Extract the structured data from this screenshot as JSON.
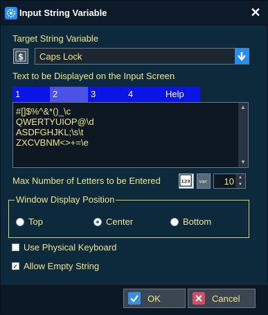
{
  "window": {
    "title": "Input String Variable"
  },
  "target": {
    "label": "Target String Variable",
    "selected": "Caps Lock",
    "icon": "string-variable-icon"
  },
  "display_text": {
    "label": "Text to be Displayed on the Input Screen",
    "tabs": [
      {
        "label": "1"
      },
      {
        "label": "2"
      },
      {
        "label": "3"
      },
      {
        "label": "4"
      },
      {
        "label": "Help"
      }
    ],
    "active_tab": "2",
    "lines": [
      "#[]$%^&*()_\\c",
      "QWERTYUIOP@\\d",
      "ASDFGHJKL;\\s\\t",
      "ZXCVBNM<>+=\\e"
    ]
  },
  "max_letters": {
    "label": "Max Number of Letters to be Entered",
    "value": "10",
    "icons": [
      "number-123-icon",
      "var-icon"
    ]
  },
  "position": {
    "title": "Window Display Position",
    "options": [
      "Top",
      "Center",
      "Bottom"
    ],
    "selected": "Center"
  },
  "options": {
    "physical_keyboard": {
      "label": "Use Physical Keyboard",
      "checked": false
    },
    "allow_empty": {
      "label": "Allow Empty String",
      "checked": true
    }
  },
  "buttons": {
    "ok": "OK",
    "cancel": "Cancel"
  },
  "colors": {
    "accent": "#1e90ff",
    "tab_bar": "#0a14e6",
    "text": "#f0e68c",
    "background": "#0d2a3c"
  }
}
